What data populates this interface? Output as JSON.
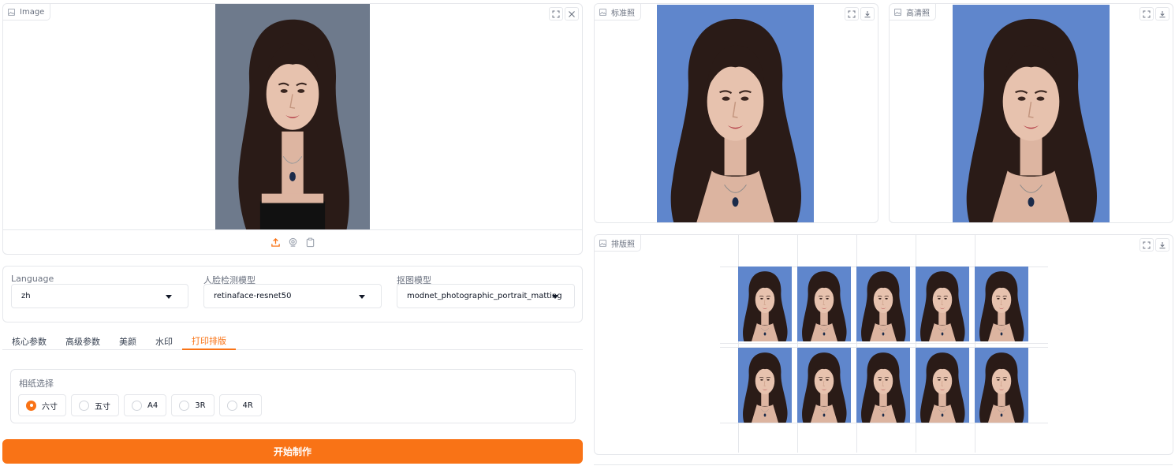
{
  "input_panel": {
    "label": "Image",
    "label_icon": "image-icon",
    "controls": [
      "fullscreen-icon",
      "close-icon"
    ],
    "source_icons": [
      "upload-icon",
      "webcam-icon",
      "clipboard-icon"
    ]
  },
  "settings": {
    "language": {
      "label": "Language",
      "value": "zh"
    },
    "face_model": {
      "label": "人脸检测模型",
      "value": "retinaface-resnet50"
    },
    "matting_model": {
      "label": "抠图模型",
      "value": "modnet_photographic_portrait_matting"
    }
  },
  "tabs": [
    "核心参数",
    "高级参数",
    "美颜",
    "水印",
    "打印排版"
  ],
  "active_tab": "打印排版",
  "paper": {
    "label": "相纸选择",
    "options": [
      "六寸",
      "五寸",
      "A4",
      "3R",
      "4R"
    ],
    "selected": "六寸"
  },
  "submit_label": "开始制作",
  "outputs": {
    "standard": {
      "label": "标准照"
    },
    "hd": {
      "label": "高清照"
    },
    "layout": {
      "label": "排版照"
    },
    "controls": [
      "fullscreen-icon",
      "download-icon"
    ]
  },
  "colors": {
    "accent": "#f97316",
    "photo_background": "#5f86cc",
    "input_background": "#6e7a8c",
    "hair": "#2a1b17",
    "skin": "#e7c2ae"
  }
}
